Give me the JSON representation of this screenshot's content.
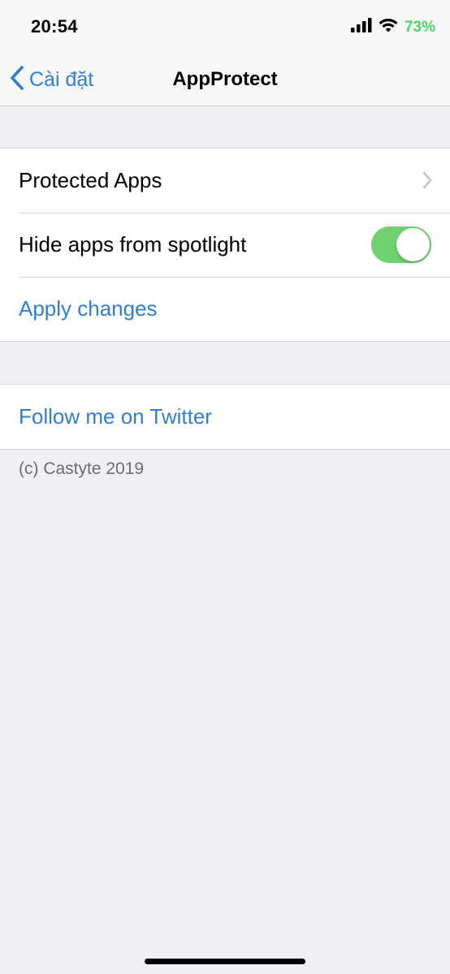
{
  "status_bar": {
    "time": "20:54",
    "battery_percent": "73%",
    "battery_color": "#4cd964",
    "signal_icon": "cellular-signal-icon",
    "wifi_icon": "wifi-icon"
  },
  "nav": {
    "back_label": "Cài đặt",
    "back_icon": "chevron-left-icon",
    "title": "AppProtect"
  },
  "section1": {
    "protected_apps_label": "Protected Apps",
    "hide_spotlight_label": "Hide apps from spotlight",
    "hide_spotlight_on": true,
    "apply_changes_label": "Apply changes"
  },
  "section2": {
    "twitter_label": "Follow me on Twitter"
  },
  "footer": {
    "copyright": "(c) Castyte 2019"
  },
  "colors": {
    "accent": "#2f7fd6",
    "toggle_on": "#6fd26f",
    "background": "#efeff4"
  }
}
